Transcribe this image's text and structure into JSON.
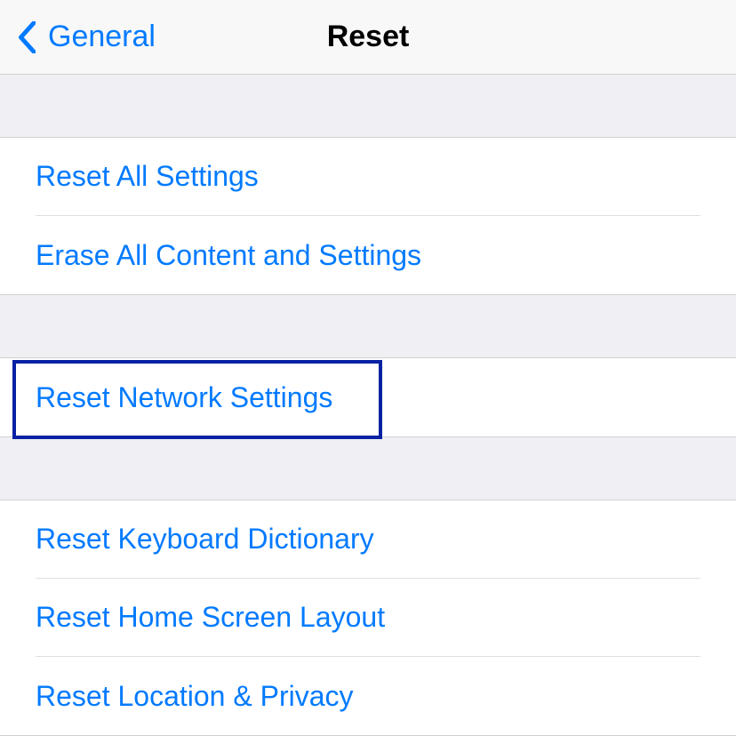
{
  "navbar": {
    "back_label": "General",
    "title": "Reset"
  },
  "section1": {
    "items": [
      {
        "label": "Reset All Settings"
      },
      {
        "label": "Erase All Content and Settings"
      }
    ]
  },
  "section2": {
    "items": [
      {
        "label": "Reset Network Settings"
      }
    ]
  },
  "section3": {
    "items": [
      {
        "label": "Reset Keyboard Dictionary"
      },
      {
        "label": "Reset Home Screen Layout"
      },
      {
        "label": "Reset Location & Privacy"
      }
    ]
  }
}
